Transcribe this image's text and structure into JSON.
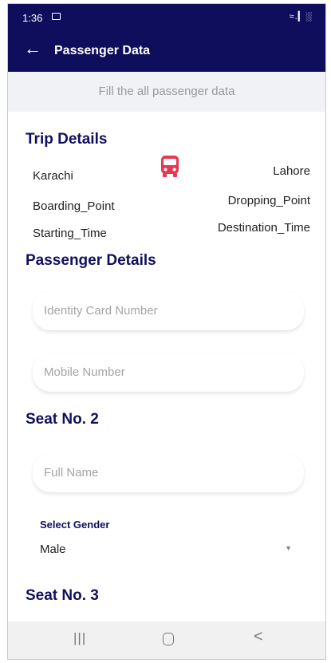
{
  "status": {
    "time": "1:36",
    "right_icons": "≈.▎░"
  },
  "appbar": {
    "back_icon": "←",
    "title": "Passenger Data"
  },
  "banner": "Fill the all passenger data",
  "trip": {
    "title": "Trip Details",
    "from": "Karachi",
    "to": "Lahore",
    "boarding": "Boarding_Point",
    "dropping": "Dropping_Point",
    "start_time": "Starting_Time",
    "dest_time": "Destination_Time",
    "bus_icon_color": "#e63950"
  },
  "passenger": {
    "title": "Passenger Details",
    "id_placeholder": "Identity Card Number",
    "mobile_placeholder": "Mobile Number"
  },
  "seat2": {
    "title": "Seat No. 2",
    "name_placeholder": "Full Name",
    "gender_label": "Select Gender",
    "gender_value": "Male"
  },
  "seat3": {
    "title": "Seat No. 3"
  },
  "nav": {
    "recent": "|||",
    "back": "<"
  },
  "colors": {
    "primary": "#0f0e5c",
    "banner_bg": "#f1f2f5",
    "accent": "#e63950"
  }
}
